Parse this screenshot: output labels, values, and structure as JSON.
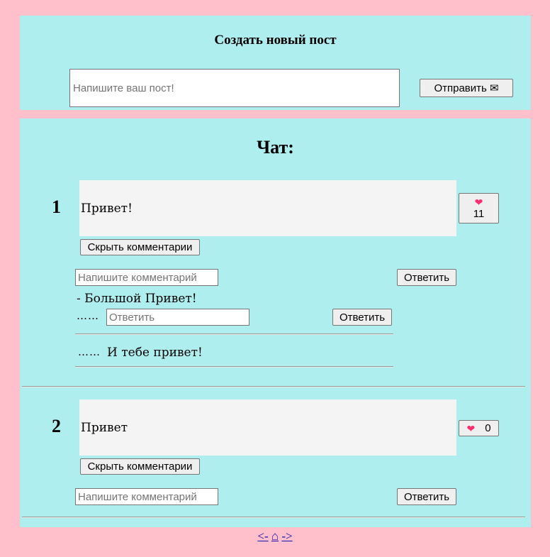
{
  "create": {
    "title": "Создать новый пост",
    "input_placeholder": "Напишите ваш пост!",
    "send_label": "Отправить ✉"
  },
  "chat": {
    "title": "Чат:",
    "posts": [
      {
        "number": "1",
        "text": "Привет!",
        "likes": "11",
        "hide_label": "Скрыть комментарии",
        "comment_placeholder": "Напишите комментарий",
        "reply_label": "Ответить",
        "comments": [
          {
            "text": "- Большой Привет!",
            "reply_dots": "……",
            "reply_placeholder": "Ответить",
            "reply_label": "Ответить",
            "replies": [
              {
                "dots": "……",
                "text": "И тебе привет!"
              }
            ]
          }
        ]
      },
      {
        "number": "2",
        "text": "Привет",
        "likes": "0",
        "hide_label": "Скрыть комментарии",
        "comment_placeholder": "Напишите комментарий",
        "reply_label": "Ответить",
        "comments": []
      }
    ]
  },
  "nav": {
    "prev": "<-",
    "home": "⌂",
    "next": "->"
  },
  "colors": {
    "background": "#ffc0cb",
    "panel": "#afeeee",
    "post_body": "#f4f4f4",
    "link": "#1a0dab"
  },
  "icons": {
    "like": "heart-icon",
    "send": "envelope-icon",
    "home": "home-icon"
  }
}
